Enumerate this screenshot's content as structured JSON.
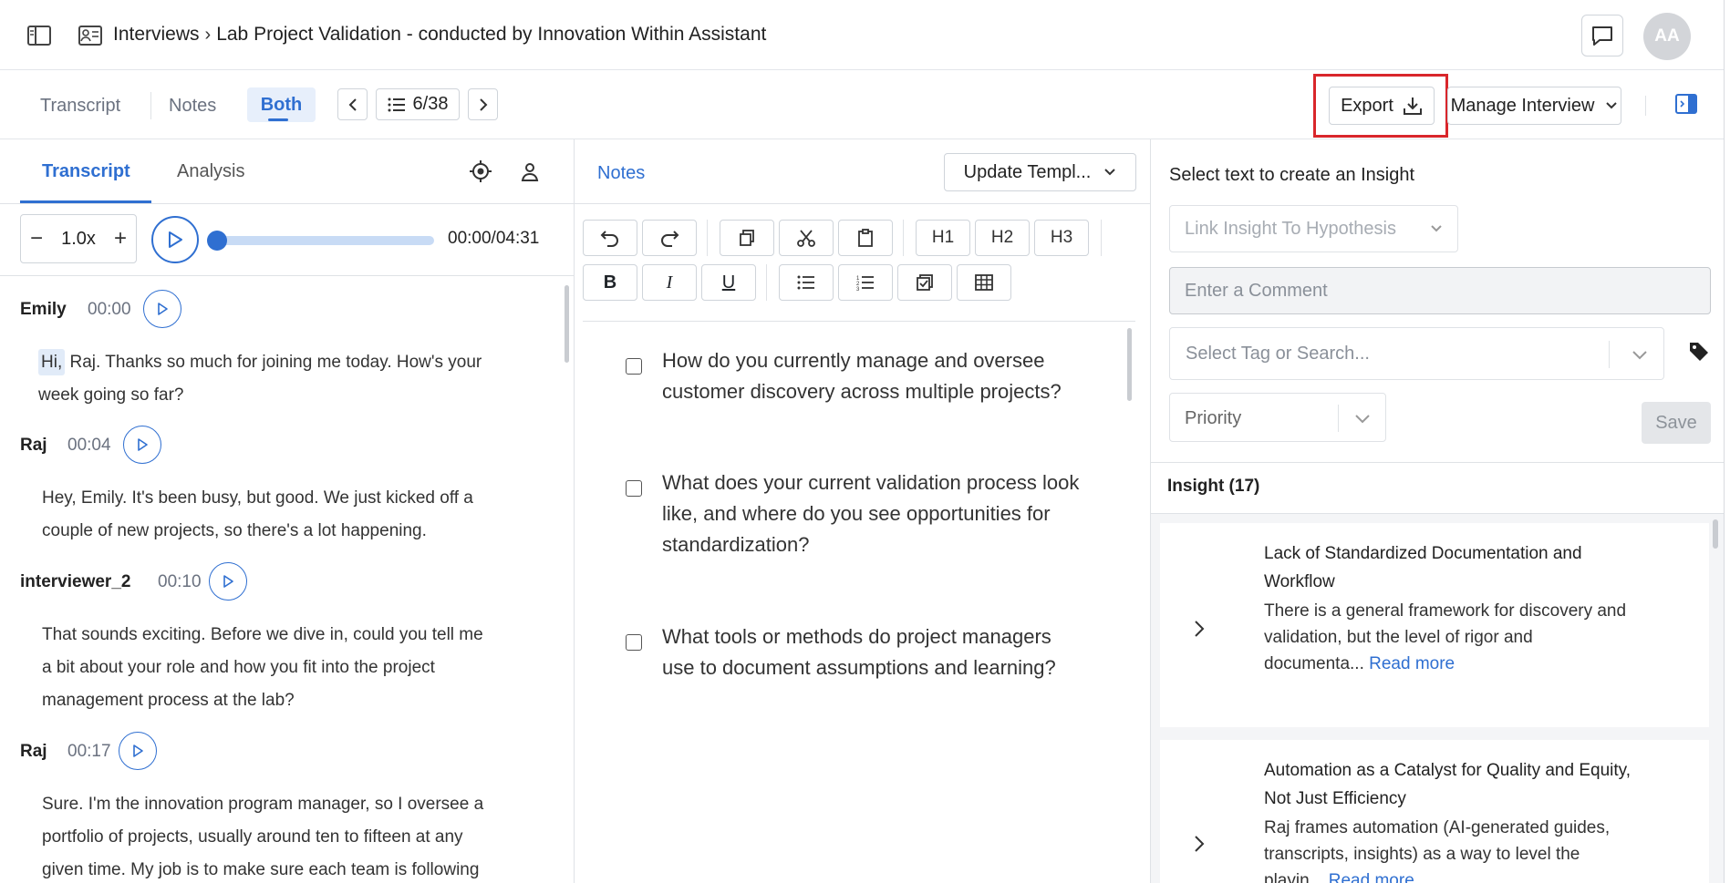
{
  "breadcrumb": {
    "section": "Interviews",
    "title": "Lab Project Validation - conducted by Innovation Within Assistant"
  },
  "user": {
    "initials": "AA"
  },
  "view_tabs": [
    "Transcript",
    "Notes",
    "Both"
  ],
  "active_view": "Both",
  "pager": {
    "label": "6/38"
  },
  "toolbar": {
    "export_label": "Export",
    "manage_label": "Manage Interview"
  },
  "left_tabs": {
    "transcript": "Transcript",
    "analysis": "Analysis"
  },
  "player": {
    "speed": "1.0x",
    "time": "00:00/04:31",
    "progress": 0
  },
  "transcript": [
    {
      "speaker": "Emily",
      "time": "00:00",
      "highlight": "Hi,",
      "text_lines": [
        "Raj. Thanks so much for joining me today. How's your",
        "week going so far?"
      ]
    },
    {
      "speaker": "Raj",
      "time": "00:04",
      "text_lines": [
        "Hey, Emily. It's been busy, but good. We just kicked off a",
        "couple of new projects, so there's a lot happening."
      ]
    },
    {
      "speaker": "interviewer_2",
      "time": "00:10",
      "text_lines": [
        "That sounds exciting. Before we dive in, could you tell me",
        "a bit about your role and how you fit into the project",
        "management process at the lab?"
      ]
    },
    {
      "speaker": "Raj",
      "time": "00:17",
      "text_lines": [
        "Sure. I'm the innovation program manager, so I oversee a",
        "portfolio of projects, usually around ten to fifteen at any",
        "given time. My job is to make sure each team is following"
      ]
    }
  ],
  "notes": {
    "tab_label": "Notes",
    "template_label": "Update Templ...",
    "editor_headings": [
      "H1",
      "H2",
      "H3"
    ],
    "bold_label": "B",
    "italic_label": "I",
    "underline_label": "U",
    "questions": [
      [
        "How do you currently manage and oversee",
        "customer discovery across multiple projects?"
      ],
      [
        "What does your current validation process look",
        "like, and where do you see opportunities for",
        "standardization?"
      ],
      [
        "What tools or methods do project managers",
        "use to document assumptions and learning?"
      ]
    ]
  },
  "insight_panel": {
    "prompt": "Select text to create an Insight",
    "hypothesis_placeholder": "Link Insight To Hypothesis",
    "comment_placeholder": "Enter a Comment",
    "tag_placeholder": "Select Tag or Search...",
    "priority_placeholder": "Priority",
    "save_label": "Save",
    "count_label": "Insight (17)",
    "read_more": "Read more",
    "cards": [
      {
        "title_lines": [
          "Lack of Standardized Documentation and",
          "Workflow"
        ],
        "body_lines": [
          "There is a general framework for discovery and",
          "validation, but the level of rigor and",
          "documenta..."
        ]
      },
      {
        "title_lines": [
          "Automation as a Catalyst for Quality and Equity,",
          "Not Just Efficiency"
        ],
        "body_lines": [
          "Raj frames automation (AI-generated guides,",
          "transcripts, insights) as a way to level the",
          "playin..."
        ]
      }
    ]
  },
  "colors": {
    "accent": "#2f6fd1",
    "highlight_box": "#d9262b"
  }
}
